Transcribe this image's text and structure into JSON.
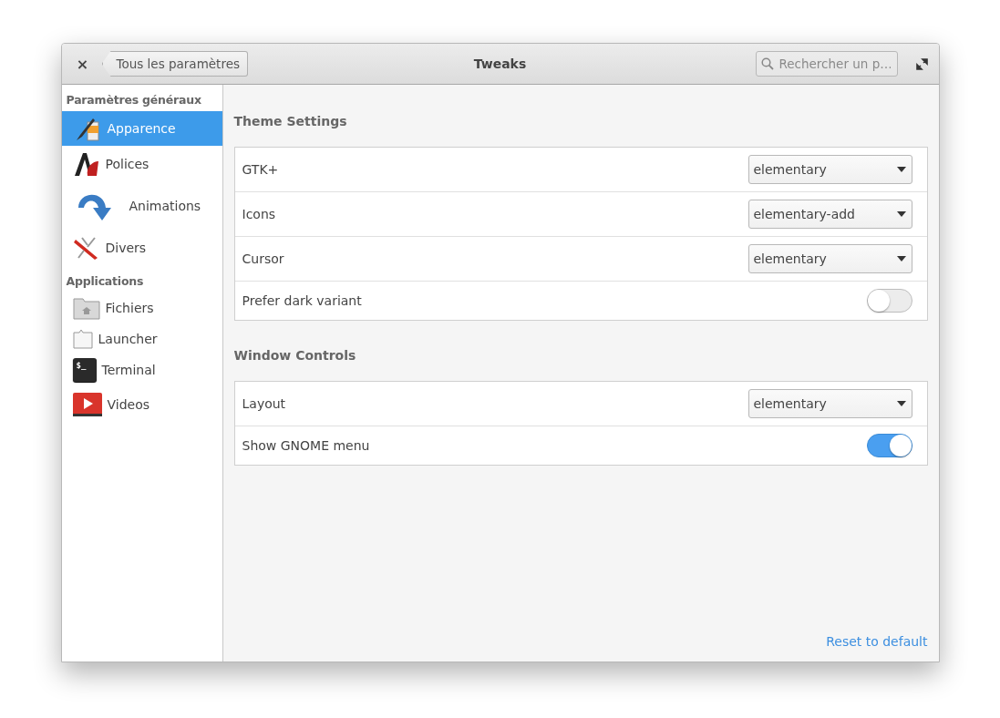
{
  "window": {
    "title": "Tweaks",
    "back_button": "Tous les paramètres",
    "close": "×",
    "search": {
      "placeholder": "Rechercher un p…"
    }
  },
  "sidebar": {
    "sections": [
      {
        "heading": "Paramètres généraux",
        "items": [
          {
            "label": "Apparence",
            "selected": true
          },
          {
            "label": "Polices",
            "selected": false
          },
          {
            "label": "Animations",
            "selected": false
          },
          {
            "label": "Divers",
            "selected": false
          }
        ]
      },
      {
        "heading": "Applications",
        "items": [
          {
            "label": "Fichiers",
            "selected": false
          },
          {
            "label": "Launcher",
            "selected": false
          },
          {
            "label": "Terminal",
            "selected": false,
            "icon_text": "$_"
          },
          {
            "label": "Videos",
            "selected": false
          }
        ]
      }
    ]
  },
  "groups": [
    {
      "title": "Theme Settings",
      "rows": [
        {
          "kind": "dropdown",
          "label": "GTK+",
          "value": "elementary"
        },
        {
          "kind": "dropdown",
          "label": "Icons",
          "value": "elementary-add"
        },
        {
          "kind": "dropdown",
          "label": "Cursor",
          "value": "elementary"
        },
        {
          "kind": "switch",
          "label": "Prefer dark variant",
          "on": false
        }
      ]
    },
    {
      "title": "Window Controls",
      "rows": [
        {
          "kind": "dropdown",
          "label": "Layout",
          "value": "elementary"
        },
        {
          "kind": "switch",
          "label": "Show GNOME menu",
          "on": true
        }
      ]
    }
  ],
  "reset_link": "Reset to default"
}
